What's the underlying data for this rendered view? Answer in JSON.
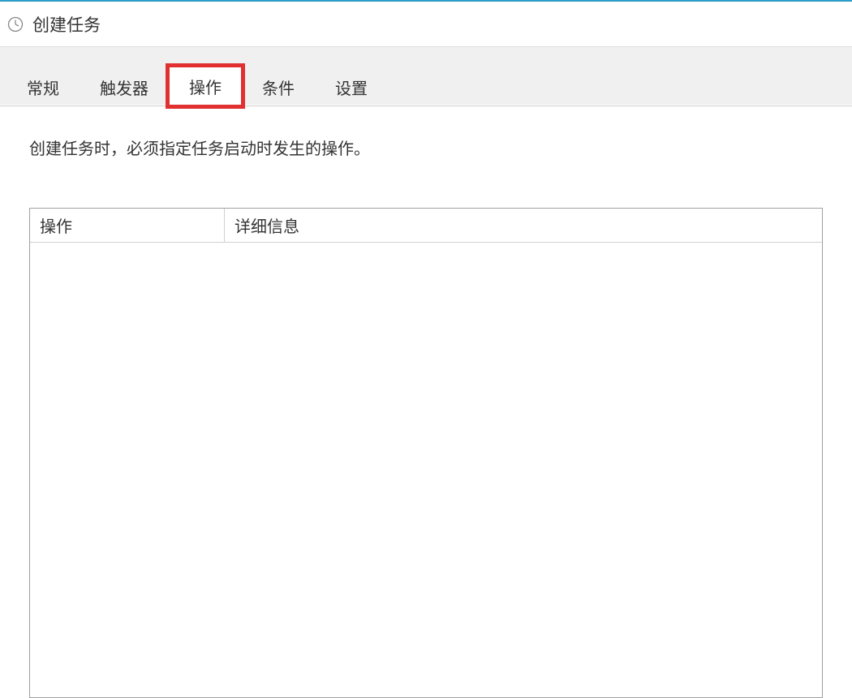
{
  "window": {
    "title": "创建任务"
  },
  "tabs": [
    {
      "label": "常规",
      "active": false
    },
    {
      "label": "触发器",
      "active": false
    },
    {
      "label": "操作",
      "active": true,
      "highlighted": true
    },
    {
      "label": "条件",
      "active": false
    },
    {
      "label": "设置",
      "active": false
    }
  ],
  "content": {
    "description": "创建任务时，必须指定任务启动时发生的操作。"
  },
  "list": {
    "columns": [
      {
        "label": "操作"
      },
      {
        "label": "详细信息"
      }
    ],
    "rows": []
  }
}
